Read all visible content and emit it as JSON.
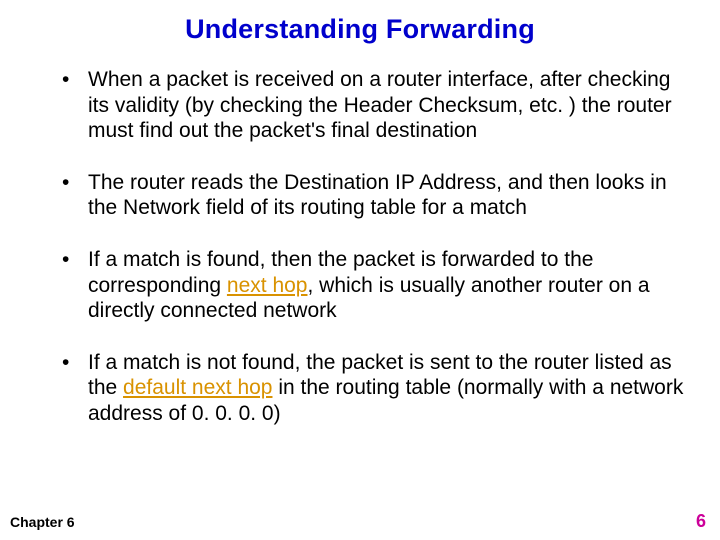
{
  "title": "Understanding Forwarding",
  "bullets": [
    {
      "pre": "When a packet is received on a router interface, after checking its validity (by checking the Header Checksum, etc. )  the router must find out the packet's final destination"
    },
    {
      "pre": "The router reads the Destination IP Address, and then looks in the Network field of its routing table for a match"
    },
    {
      "pre": "If a match is found, then the packet is forwarded to the corresponding ",
      "hl": "next hop",
      "post": ", which is usually another router on a directly connected network"
    },
    {
      "pre": "If a match is not found, the packet is sent to the router listed as the ",
      "hl": "default next hop",
      "post": " in the routing table (normally with a network address of 0. 0. 0. 0)"
    }
  ],
  "footer": {
    "chapter": "Chapter 6",
    "page": "6"
  }
}
